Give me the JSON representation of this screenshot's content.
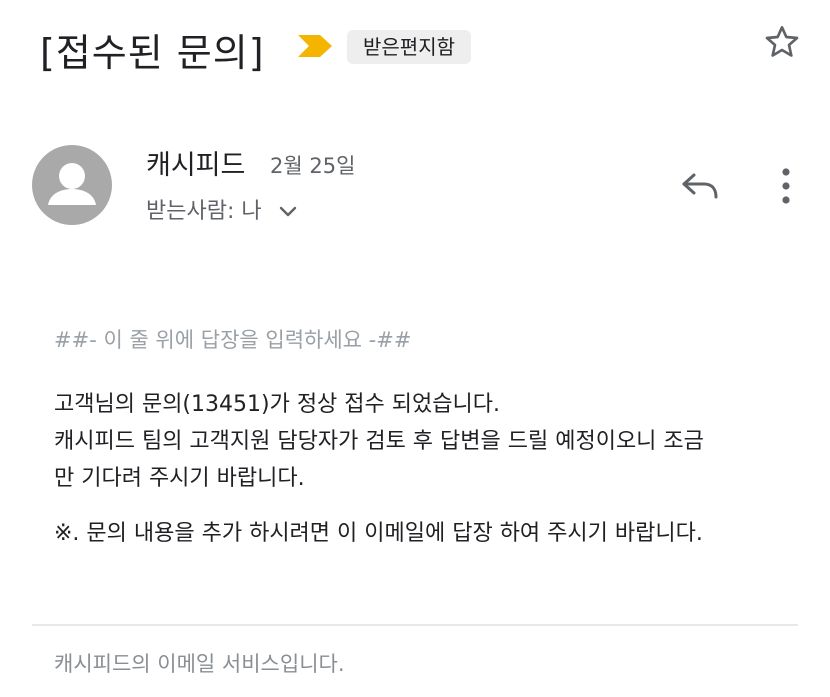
{
  "email": {
    "subject": "[접수된 문의]",
    "label": "받은편지함",
    "sender_name": "캐시피드",
    "date": "2월 25일",
    "recipient": "받는사람: 나",
    "reply_marker": "##- 이 줄 위에 답장을 입력하세요 -##",
    "body_lines": [
      "고객님의 문의(13451)가 정상 접수 되었습니다.",
      "캐시피드 팀의 고객지원 담당자가 검토 후 답변을 드릴 예정이오니 조금",
      "만 기다려 주시기 바랍니다."
    ],
    "note": "※. 문의 내용을 추가 하시려면 이 이메일에 답장 하여 주시기 바랍니다.",
    "footer": "캐시피드의 이메일 서비스입니다."
  },
  "icons": {
    "importance": "importance-marker-icon",
    "star": "star-icon",
    "avatar": "person-avatar-icon",
    "chevron": "chevron-down-icon",
    "reply": "reply-icon",
    "more": "more-vertical-icon"
  },
  "colors": {
    "importance": "#f4b400",
    "avatar": "#a9a9a9",
    "label_chip": "#eeeeee",
    "secondary_text": "#5f6368",
    "muted_text": "#9aa0a6"
  }
}
